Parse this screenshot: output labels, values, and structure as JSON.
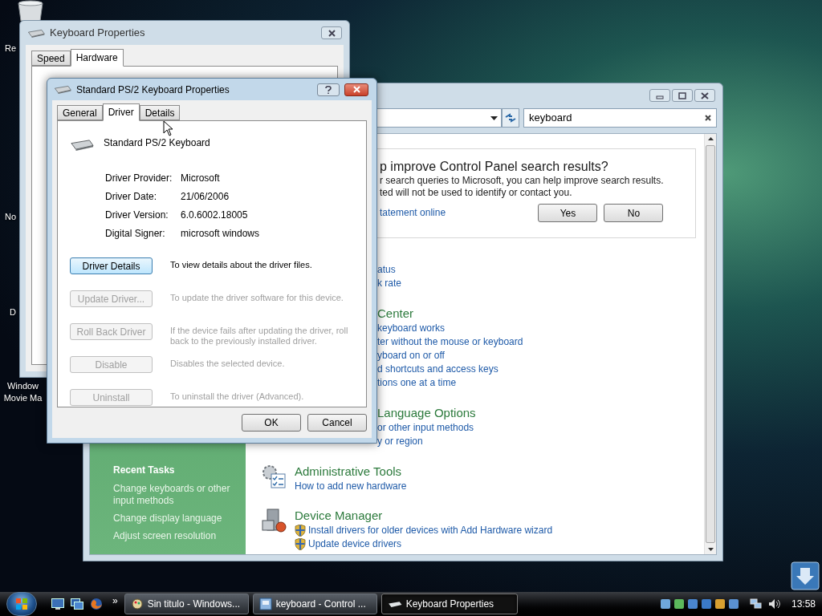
{
  "desktop_icons": [
    {
      "label": "Re"
    },
    {
      "label": "No"
    },
    {
      "label": "D"
    },
    {
      "label": "Window Movie Ma"
    }
  ],
  "keyboard_properties": {
    "title": "Keyboard Properties",
    "tabs": [
      {
        "label": "Speed",
        "selected": false
      },
      {
        "label": "Hardware",
        "selected": true
      }
    ]
  },
  "control_panel": {
    "search": {
      "value": "keyboard"
    },
    "banner": {
      "title": "p improve Control Panel search results?",
      "lines": [
        "r search queries to Microsoft, you can help improve search results.",
        "ted will not be used to identify or contact you."
      ],
      "link": "tatement online",
      "buttons": [
        "Yes",
        "No"
      ]
    },
    "sections": [
      {
        "kind": "partial",
        "links": [
          {
            "text": "atus",
            "shield": false
          },
          {
            "text": "k rate",
            "shield": false
          }
        ]
      },
      {
        "kind": "partial",
        "title": "Center",
        "links": [
          {
            "text": "keyboard works",
            "shield": false
          },
          {
            "text": "ter without the mouse or keyboard",
            "shield": false
          },
          {
            "text": "yboard on or off",
            "shield": false
          },
          {
            "text": "d shortcuts and access keys",
            "shield": false
          },
          {
            "text": "tions one at a time",
            "shield": false
          }
        ]
      },
      {
        "kind": "partial",
        "title": "Language Options",
        "links": [
          {
            "text": "or other input methods",
            "shield": false
          },
          {
            "text": "y or region",
            "shield": false
          }
        ]
      },
      {
        "kind": "tools",
        "title": "Administrative Tools",
        "links": [
          {
            "text": "How to add new hardware",
            "shield": false
          }
        ]
      },
      {
        "kind": "devices",
        "title": "Device Manager",
        "links": [
          {
            "text": "Install drivers for older devices with Add Hardware wizard",
            "shield": true
          },
          {
            "text": "Update device drivers",
            "shield": true
          }
        ]
      }
    ],
    "recent_tasks": {
      "title": "Recent Tasks",
      "items": [
        "Change keyboards or other input methods",
        "Change display language",
        "Adjust screen resolution"
      ]
    }
  },
  "driver_dialog": {
    "title": "Standard PS/2 Keyboard Properties",
    "tabs": [
      {
        "label": "General",
        "selected": false
      },
      {
        "label": "Driver",
        "selected": true
      },
      {
        "label": "Details",
        "selected": false
      }
    ],
    "device_name": "Standard PS/2 Keyboard",
    "info": [
      {
        "label": "Driver Provider:",
        "value": "Microsoft"
      },
      {
        "label": "Driver Date:",
        "value": "21/06/2006"
      },
      {
        "label": "Driver Version:",
        "value": "6.0.6002.18005"
      },
      {
        "label": "Digital Signer:",
        "value": "microsoft windows"
      }
    ],
    "actions": [
      {
        "button": "Driver Details",
        "description": "To view details about the driver files.",
        "disabled": false
      },
      {
        "button": "Update Driver...",
        "description": "To update the driver software for this device.",
        "disabled": true
      },
      {
        "button": "Roll Back Driver",
        "description": "If the device fails after updating the driver, roll back to the previously installed driver.",
        "disabled": true
      },
      {
        "button": "Disable",
        "description": "Disables the selected device.",
        "disabled": true
      },
      {
        "button": "Uninstall",
        "description": "To uninstall the driver (Advanced).",
        "disabled": true
      }
    ],
    "buttons": [
      "OK",
      "Cancel"
    ]
  },
  "taskbar": {
    "more": "»",
    "tasks": [
      {
        "label": "Sin titulo - Windows...",
        "selected": false
      },
      {
        "label": "keyboard - Control ...",
        "selected": false
      },
      {
        "label": "Keyboard Properties",
        "selected": true
      }
    ],
    "clock": "13:58"
  }
}
